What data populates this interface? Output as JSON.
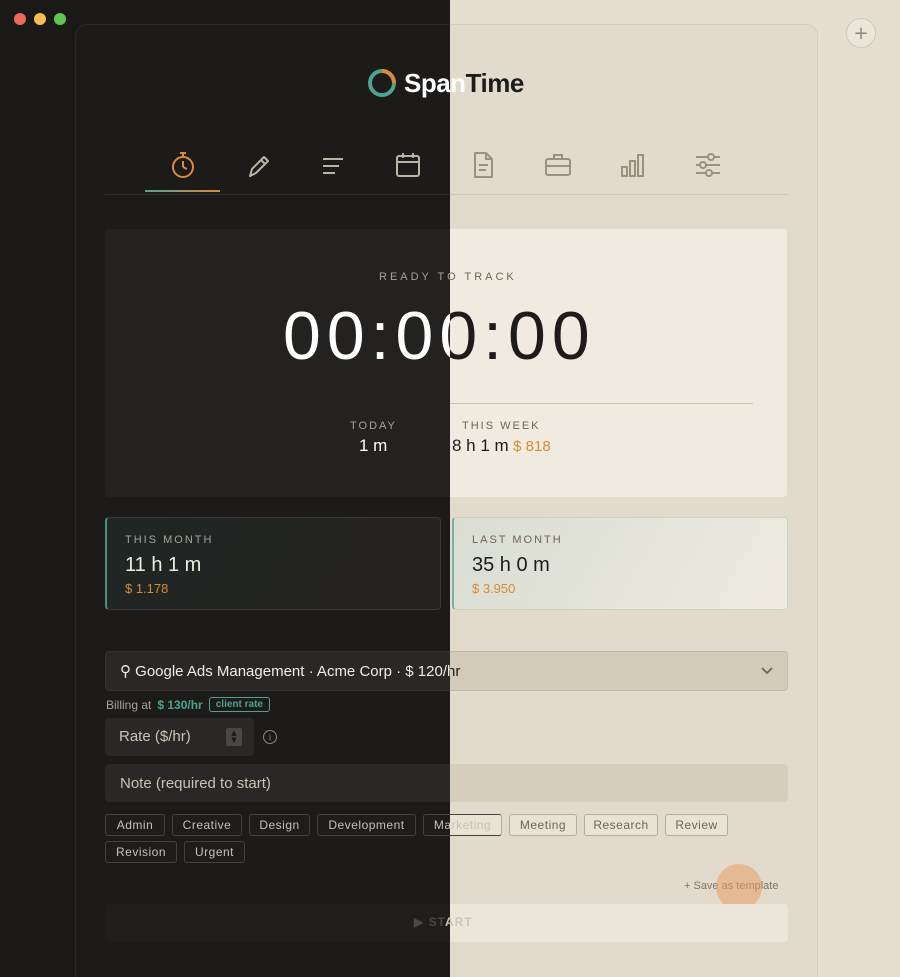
{
  "app": {
    "name_part1": "Span",
    "name_part2": "Time"
  },
  "window": {
    "add_button": "+"
  },
  "nav": {
    "items": [
      {
        "id": "timer",
        "icon": "stopwatch-icon",
        "active": true
      },
      {
        "id": "edit",
        "icon": "pencil-icon"
      },
      {
        "id": "entries",
        "icon": "list-icon"
      },
      {
        "id": "calendar",
        "icon": "calendar-icon"
      },
      {
        "id": "reports",
        "icon": "document-icon"
      },
      {
        "id": "projects",
        "icon": "briefcase-icon"
      },
      {
        "id": "stats",
        "icon": "bar-chart-icon"
      },
      {
        "id": "settings",
        "icon": "sliders-icon"
      }
    ]
  },
  "timer": {
    "status": "READY TO TRACK",
    "display": "00:00:00",
    "today_label": "TODAY",
    "today_value": "1 m",
    "week_label": "THIS WEEK",
    "week_value": "8 h 1 m",
    "week_money": "$ 818"
  },
  "months": {
    "this_label": "THIS MONTH",
    "this_value": "11 h 1 m",
    "this_money": "$ 1.178",
    "last_label": "LAST MONTH",
    "last_value": "35 h 0 m",
    "last_money": "$ 3.950"
  },
  "project": {
    "selected": "⚲ Google Ads Management · Acme Corp · $ 120/hr",
    "billing_prefix": "Billing at",
    "billing_rate": "$ 130/hr",
    "billing_badge": "client rate"
  },
  "form": {
    "rate_placeholder": "Rate ($/hr)",
    "note_placeholder": "Note (required to start)"
  },
  "tags": [
    "Admin",
    "Creative",
    "Design",
    "Development",
    "Marketing",
    "Meeting",
    "Research",
    "Review",
    "Revision",
    "Urgent"
  ],
  "actions": {
    "save_template": "+ Save as template",
    "start_a": "▶ ST",
    "start_b": "ART"
  },
  "colors": {
    "accent_orange": "#d98a3a",
    "accent_teal": "#4fa28e",
    "dark_bg": "#1a1918",
    "light_bg": "#e4ddd0"
  }
}
